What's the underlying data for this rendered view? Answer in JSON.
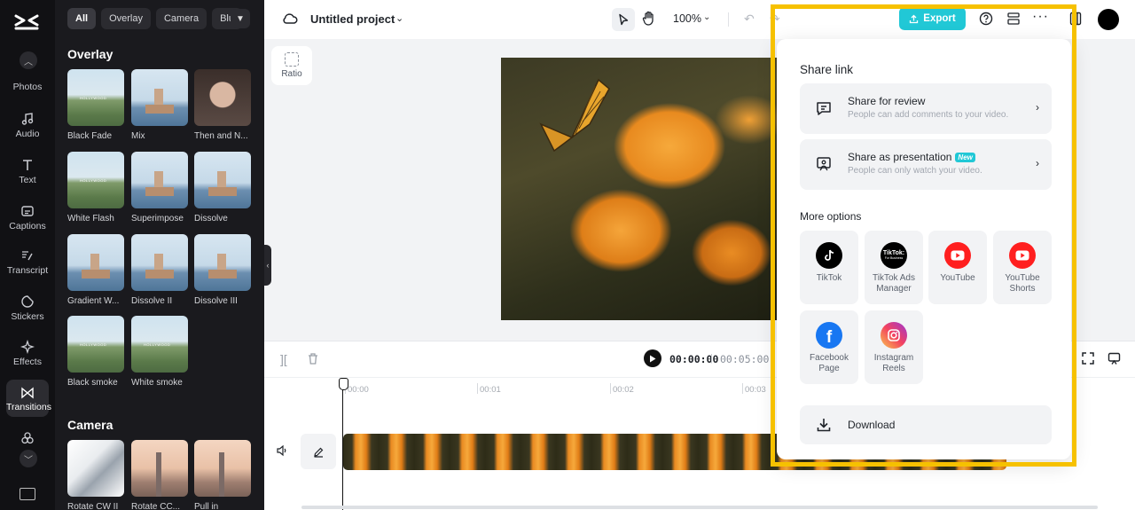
{
  "rail": {
    "items": [
      {
        "label": "Photos"
      },
      {
        "label": "Audio"
      },
      {
        "label": "Text"
      },
      {
        "label": "Captions"
      },
      {
        "label": "Transcript"
      },
      {
        "label": "Stickers"
      },
      {
        "label": "Effects"
      },
      {
        "label": "Transitions"
      }
    ]
  },
  "panel": {
    "chips": [
      "All",
      "Overlay",
      "Camera",
      "Blu"
    ],
    "sections": [
      {
        "title": "Overlay",
        "items": [
          "Black Fade",
          "Mix",
          "Then and N...",
          "White Flash",
          "Superimpose",
          "Dissolve",
          "Gradient W...",
          "Dissolve II",
          "Dissolve III",
          "Black smoke",
          "White smoke"
        ]
      },
      {
        "title": "Camera",
        "items": [
          "Rotate CW II",
          "Rotate CC...",
          "Pull in"
        ]
      }
    ]
  },
  "topbar": {
    "project_title": "Untitled project",
    "zoom": "100%",
    "export_label": "Export"
  },
  "canvas": {
    "ratio_label": "Ratio"
  },
  "timeline": {
    "current_time": "00:00:00",
    "separator": "|",
    "total_time": "00:05:00",
    "ruler_ticks": [
      "00:00",
      "00:01",
      "00:02",
      "00:03"
    ]
  },
  "share": {
    "title": "Share link",
    "review": {
      "title": "Share for review",
      "subtitle": "People can add comments to your video."
    },
    "presentation": {
      "title": "Share as presentation",
      "badge": "New",
      "subtitle": "People can only watch your video."
    },
    "more_options_title": "More options",
    "platforms": [
      {
        "label": "TikTok"
      },
      {
        "label": "TikTok Ads Manager",
        "logo_text": "TikTok:",
        "logo_subtext": "For Business"
      },
      {
        "label": "YouTube"
      },
      {
        "label": "YouTube Shorts"
      },
      {
        "label": "Facebook Page"
      },
      {
        "label": "Instagram Reels"
      }
    ],
    "download_label": "Download"
  },
  "colors": {
    "accent": "#21c8d6",
    "highlight": "#f6c100",
    "rail_bg": "#111114",
    "panel_bg": "#1a1a1e"
  }
}
